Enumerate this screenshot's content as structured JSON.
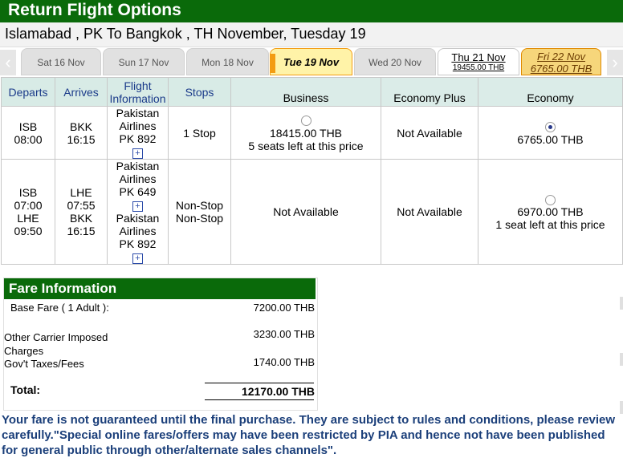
{
  "header": {
    "title": "Return Flight Options",
    "route": "Islamabad , PK To Bangkok , TH November, Tuesday 19"
  },
  "dates": [
    {
      "label": "Sat 16 Nov",
      "price": ""
    },
    {
      "label": "Sun 17 Nov",
      "price": ""
    },
    {
      "label": "Mon 18 Nov",
      "price": ""
    },
    {
      "label": "Tue 19 Nov",
      "price": ""
    },
    {
      "label": "Wed 20 Nov",
      "price": ""
    },
    {
      "label": "Thu 21 Nov",
      "price": "19455.00 THB"
    },
    {
      "label": "Fri 22 Nov",
      "price": "6765.00 THB"
    }
  ],
  "table": {
    "headers": {
      "departs": "Departs",
      "arrives": "Arrives",
      "flight_info": "Flight Information",
      "stops": "Stops",
      "business": "Business",
      "economy_plus": "Economy Plus",
      "economy": "Economy"
    },
    "rows": [
      {
        "departs": [
          "ISB",
          "08:00"
        ],
        "arrives": [
          "BKK",
          "16:15"
        ],
        "flights": [
          {
            "airline": "Pakistan Airlines",
            "number": "PK 892"
          }
        ],
        "stops": [
          "1 Stop"
        ],
        "business": {
          "price": "18415.00 THB",
          "note": "5 seats left at this price",
          "selected": false
        },
        "economy_plus": "Not Available",
        "economy": {
          "price": "6765.00 THB",
          "note": "",
          "selected": true
        }
      },
      {
        "departs": [
          "ISB",
          "07:00",
          "LHE",
          "09:50"
        ],
        "arrives": [
          "LHE",
          "07:55",
          "BKK",
          "16:15"
        ],
        "flights": [
          {
            "airline": "Pakistan Airlines",
            "number": "PK 649"
          },
          {
            "airline": "Pakistan Airlines",
            "number": "PK 892"
          }
        ],
        "stops": [
          "Non-Stop",
          "Non-Stop"
        ],
        "business": "Not Available",
        "economy_plus": "Not Available",
        "economy": {
          "price": "6970.00 THB",
          "note": "1 seat left at this price",
          "selected": false
        }
      }
    ]
  },
  "fare": {
    "title": "Fare Information",
    "base_label": "Base Fare ( 1 Adult ):",
    "base_value": "7200.00 THB",
    "carrier_label": "Other Carrier Imposed Charges",
    "carrier_value": "3230.00 THB",
    "taxes_label": "Gov't Taxes/Fees",
    "taxes_value": "1740.00 THB",
    "total_label": "Total:",
    "total_value": "12170.00 THB"
  },
  "notice": "Your fare is not guaranteed until the final purchase. They are subject to rules and conditions, please review carefully.\"Special online fares/offers may have been restricted by PIA and hence not have been published for general public through other/alternate sales channels\".",
  "icons": {
    "left_arrow": "chevron-left-icon",
    "right_arrow": "chevron-right-icon",
    "expand": "plus-icon"
  },
  "colors": {
    "brand_green": "#0a6a0a",
    "selected_tab": "#fff3a8",
    "notice_blue": "#1b3f7a"
  }
}
